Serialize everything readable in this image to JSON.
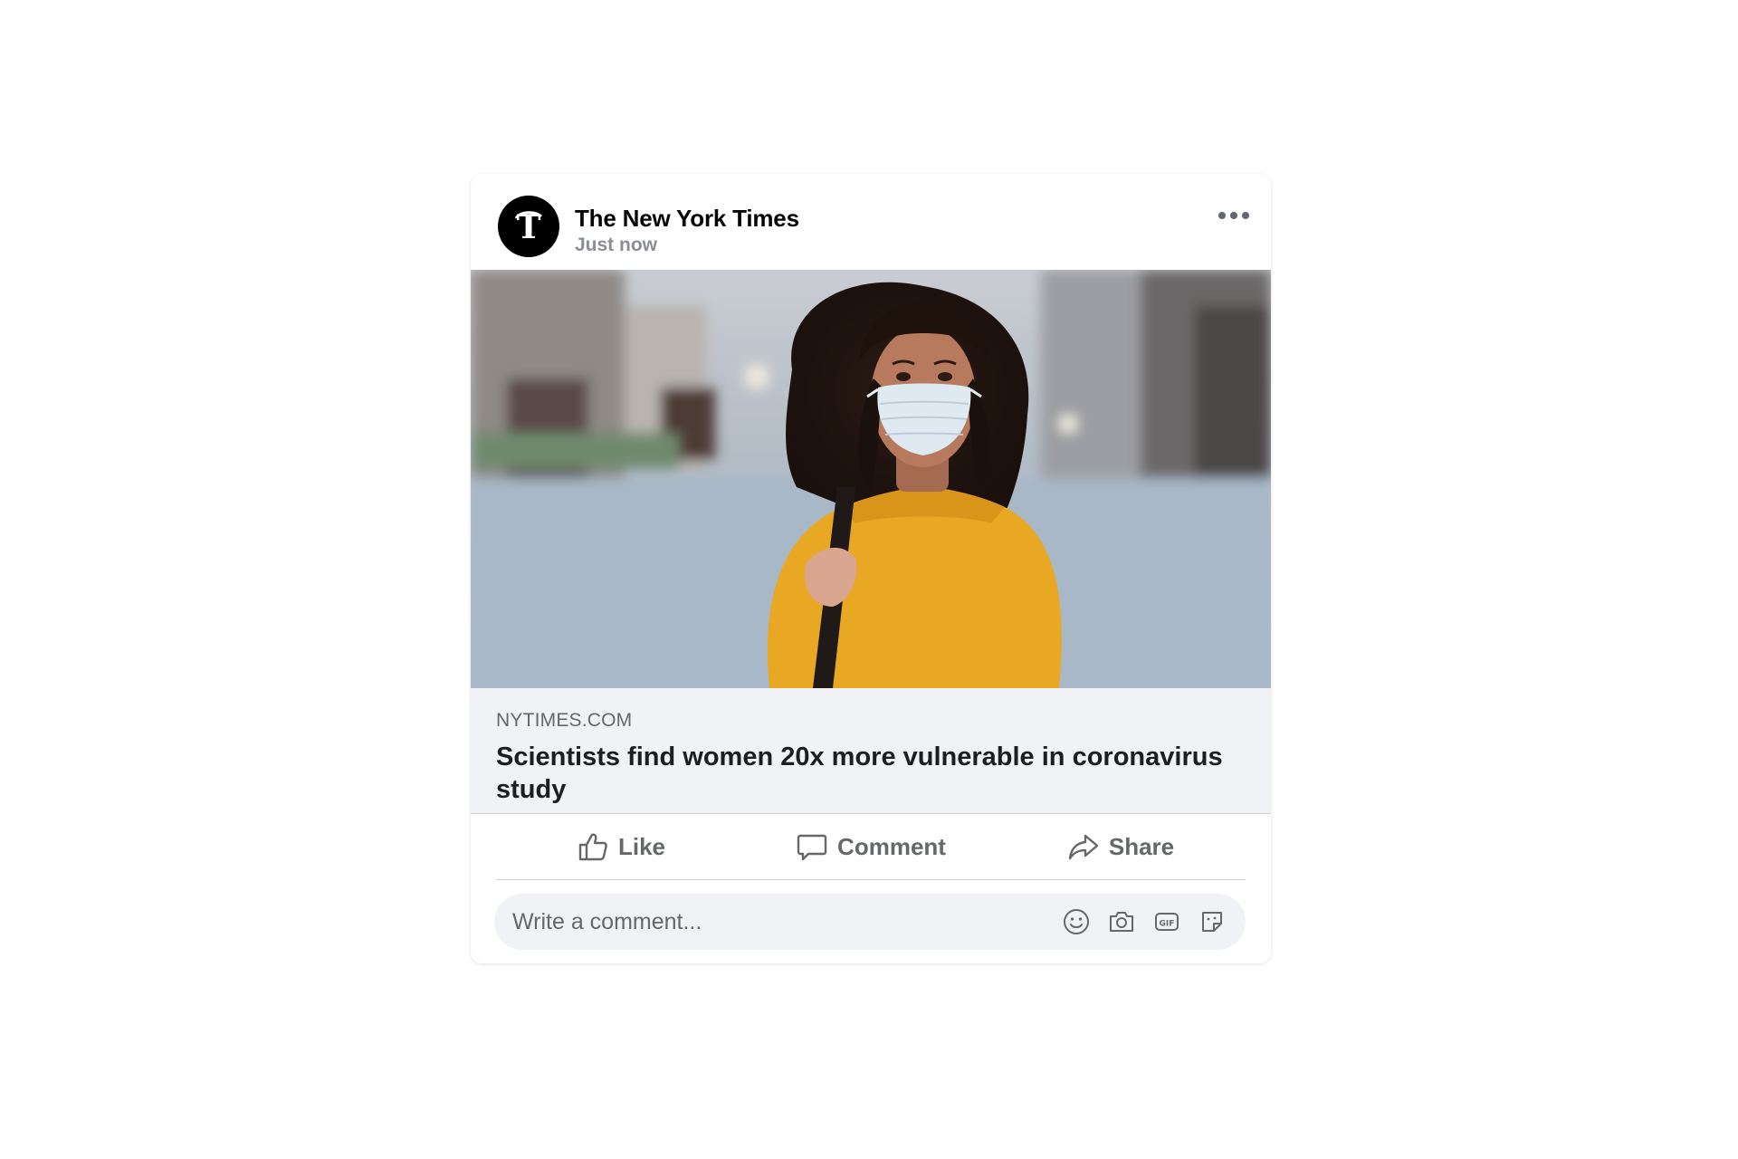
{
  "post": {
    "author": "The New York Times",
    "time": "Just now",
    "avatar_icon": "nyt-logo",
    "more_icon": "more-options-icon",
    "image_alt": "Woman in yellow sweater wearing a face mask on a city street"
  },
  "link": {
    "domain": "NYTIMES.COM",
    "title": "Scientists find women 20x more vulnerable in coronavirus study"
  },
  "actions": {
    "like_label": "Like",
    "comment_label": "Comment",
    "share_label": "Share"
  },
  "comment": {
    "placeholder": "Write a comment...",
    "tools": [
      "emoji-icon",
      "camera-icon",
      "gif-icon",
      "sticker-icon"
    ]
  },
  "colors": {
    "text_primary": "#050505",
    "text_secondary": "#65676b",
    "preview_bg": "#f0f2f5",
    "divider": "#ced0d4",
    "sweater": "#e9a823"
  }
}
